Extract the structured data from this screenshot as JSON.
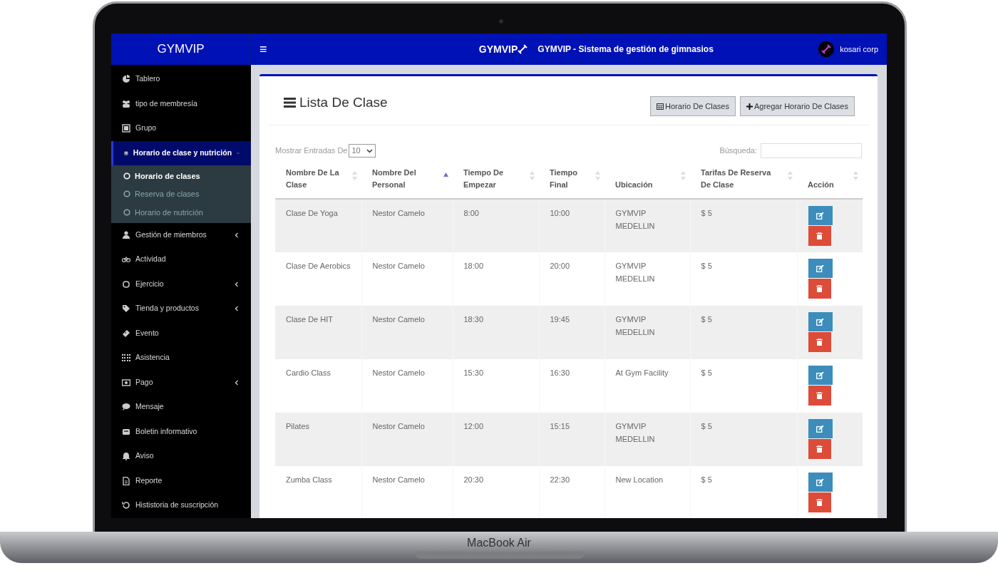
{
  "device": {
    "label": "MacBook Air"
  },
  "header": {
    "brand": "GYMVIP",
    "logo_text": "GYMVIP",
    "title": "GYMVIP - Sistema de gestión de gimnasios",
    "menu_glyph": "≡",
    "user": "kosari corp"
  },
  "sidebar": {
    "items": [
      {
        "label": "Tablero",
        "selected": false,
        "has_submenu": false
      },
      {
        "label": "tipo de membresía",
        "selected": false,
        "has_submenu": false
      },
      {
        "label": "Grupo",
        "selected": false,
        "has_submenu": false
      },
      {
        "label": "Horario de clase y nutrición",
        "selected": true,
        "has_submenu": true,
        "expanded": true,
        "children": [
          {
            "label": "Horario de clases",
            "selected": true
          },
          {
            "label": "Reserva de clases",
            "selected": false
          },
          {
            "label": "Horario de nutrición",
            "selected": false
          }
        ]
      },
      {
        "label": "Gestión de miembros",
        "selected": false,
        "has_submenu": true,
        "expanded": false
      },
      {
        "label": "Actividad",
        "selected": false,
        "has_submenu": false
      },
      {
        "label": "Ejercicio",
        "selected": false,
        "has_submenu": true,
        "expanded": false
      },
      {
        "label": "Tienda y productos",
        "selected": false,
        "has_submenu": true,
        "expanded": false
      },
      {
        "label": "Evento",
        "selected": false,
        "has_submenu": false
      },
      {
        "label": "Asistencia",
        "selected": false,
        "has_submenu": false
      },
      {
        "label": "Pago",
        "selected": false,
        "has_submenu": true,
        "expanded": false
      },
      {
        "label": "Mensaje",
        "selected": false,
        "has_submenu": false
      },
      {
        "label": "Boletin informativo",
        "selected": false,
        "has_submenu": false
      },
      {
        "label": "Aviso",
        "selected": false,
        "has_submenu": false
      },
      {
        "label": "Reporte",
        "selected": false,
        "has_submenu": false
      },
      {
        "label": "Hististoria de suscripción",
        "selected": false,
        "has_submenu": false
      }
    ]
  },
  "card": {
    "title": "Lista De Clase",
    "buttons": [
      {
        "label": "Horario De Clases",
        "kind": "calendar"
      },
      {
        "label": "Agregar Horario De Clases",
        "kind": "add"
      }
    ]
  },
  "table": {
    "length_label": "Mostrar Entradas De",
    "length_value": "10",
    "search_label": "Búsqueda:",
    "columns": [
      {
        "label": "Nombre De La Clase",
        "sorted": false
      },
      {
        "label": "Nombre Del Personal",
        "sorted": true
      },
      {
        "label": "Tiempo De Empezar",
        "sorted": false
      },
      {
        "label": "Tiempo Final",
        "sorted": false
      },
      {
        "label": "Ubicación",
        "sorted": false
      },
      {
        "label": "Tarifas De Reserva De Clase",
        "sorted": false
      },
      {
        "label": "Acción",
        "sorted": false
      }
    ],
    "rows": [
      [
        "Clase De Yoga",
        "Nestor Camelo",
        "8:00",
        "10:00",
        "GYMVIP MEDELLIN",
        "$ 5"
      ],
      [
        "Clase De Aerobics",
        "Nestor Camelo",
        "18:00",
        "20:00",
        "GYMVIP MEDELLIN",
        "$ 5"
      ],
      [
        "Clase De HIT",
        "Nestor Camelo",
        "18:30",
        "19:45",
        "GYMVIP MEDELLIN",
        "$ 5"
      ],
      [
        "Cardio Class",
        "Nestor Camelo",
        "15:30",
        "16:30",
        "At Gym Facility",
        "$ 5"
      ],
      [
        "Pilates",
        "Nestor Camelo",
        "12:00",
        "15:15",
        "GYMVIP MEDELLIN",
        "$ 5"
      ],
      [
        "Zumba Class",
        "Nestor Camelo",
        "20:30",
        "22:30",
        "New Location",
        "$ 5"
      ]
    ]
  }
}
